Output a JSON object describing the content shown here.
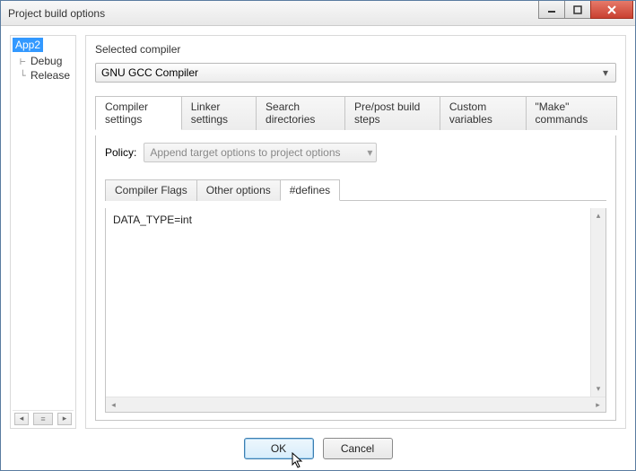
{
  "window": {
    "title": "Project build options"
  },
  "tree": {
    "root": "App2",
    "children": [
      "Debug",
      "Release"
    ]
  },
  "compiler": {
    "label": "Selected compiler",
    "value": "GNU GCC Compiler"
  },
  "tabs": [
    "Compiler settings",
    "Linker settings",
    "Search directories",
    "Pre/post build steps",
    "Custom variables",
    "\"Make\" commands"
  ],
  "policy": {
    "label": "Policy:",
    "value": "Append target options to project options"
  },
  "subtabs": [
    "Compiler Flags",
    "Other options",
    "#defines"
  ],
  "defines_text": "DATA_TYPE=int",
  "buttons": {
    "ok": "OK",
    "cancel": "Cancel"
  }
}
